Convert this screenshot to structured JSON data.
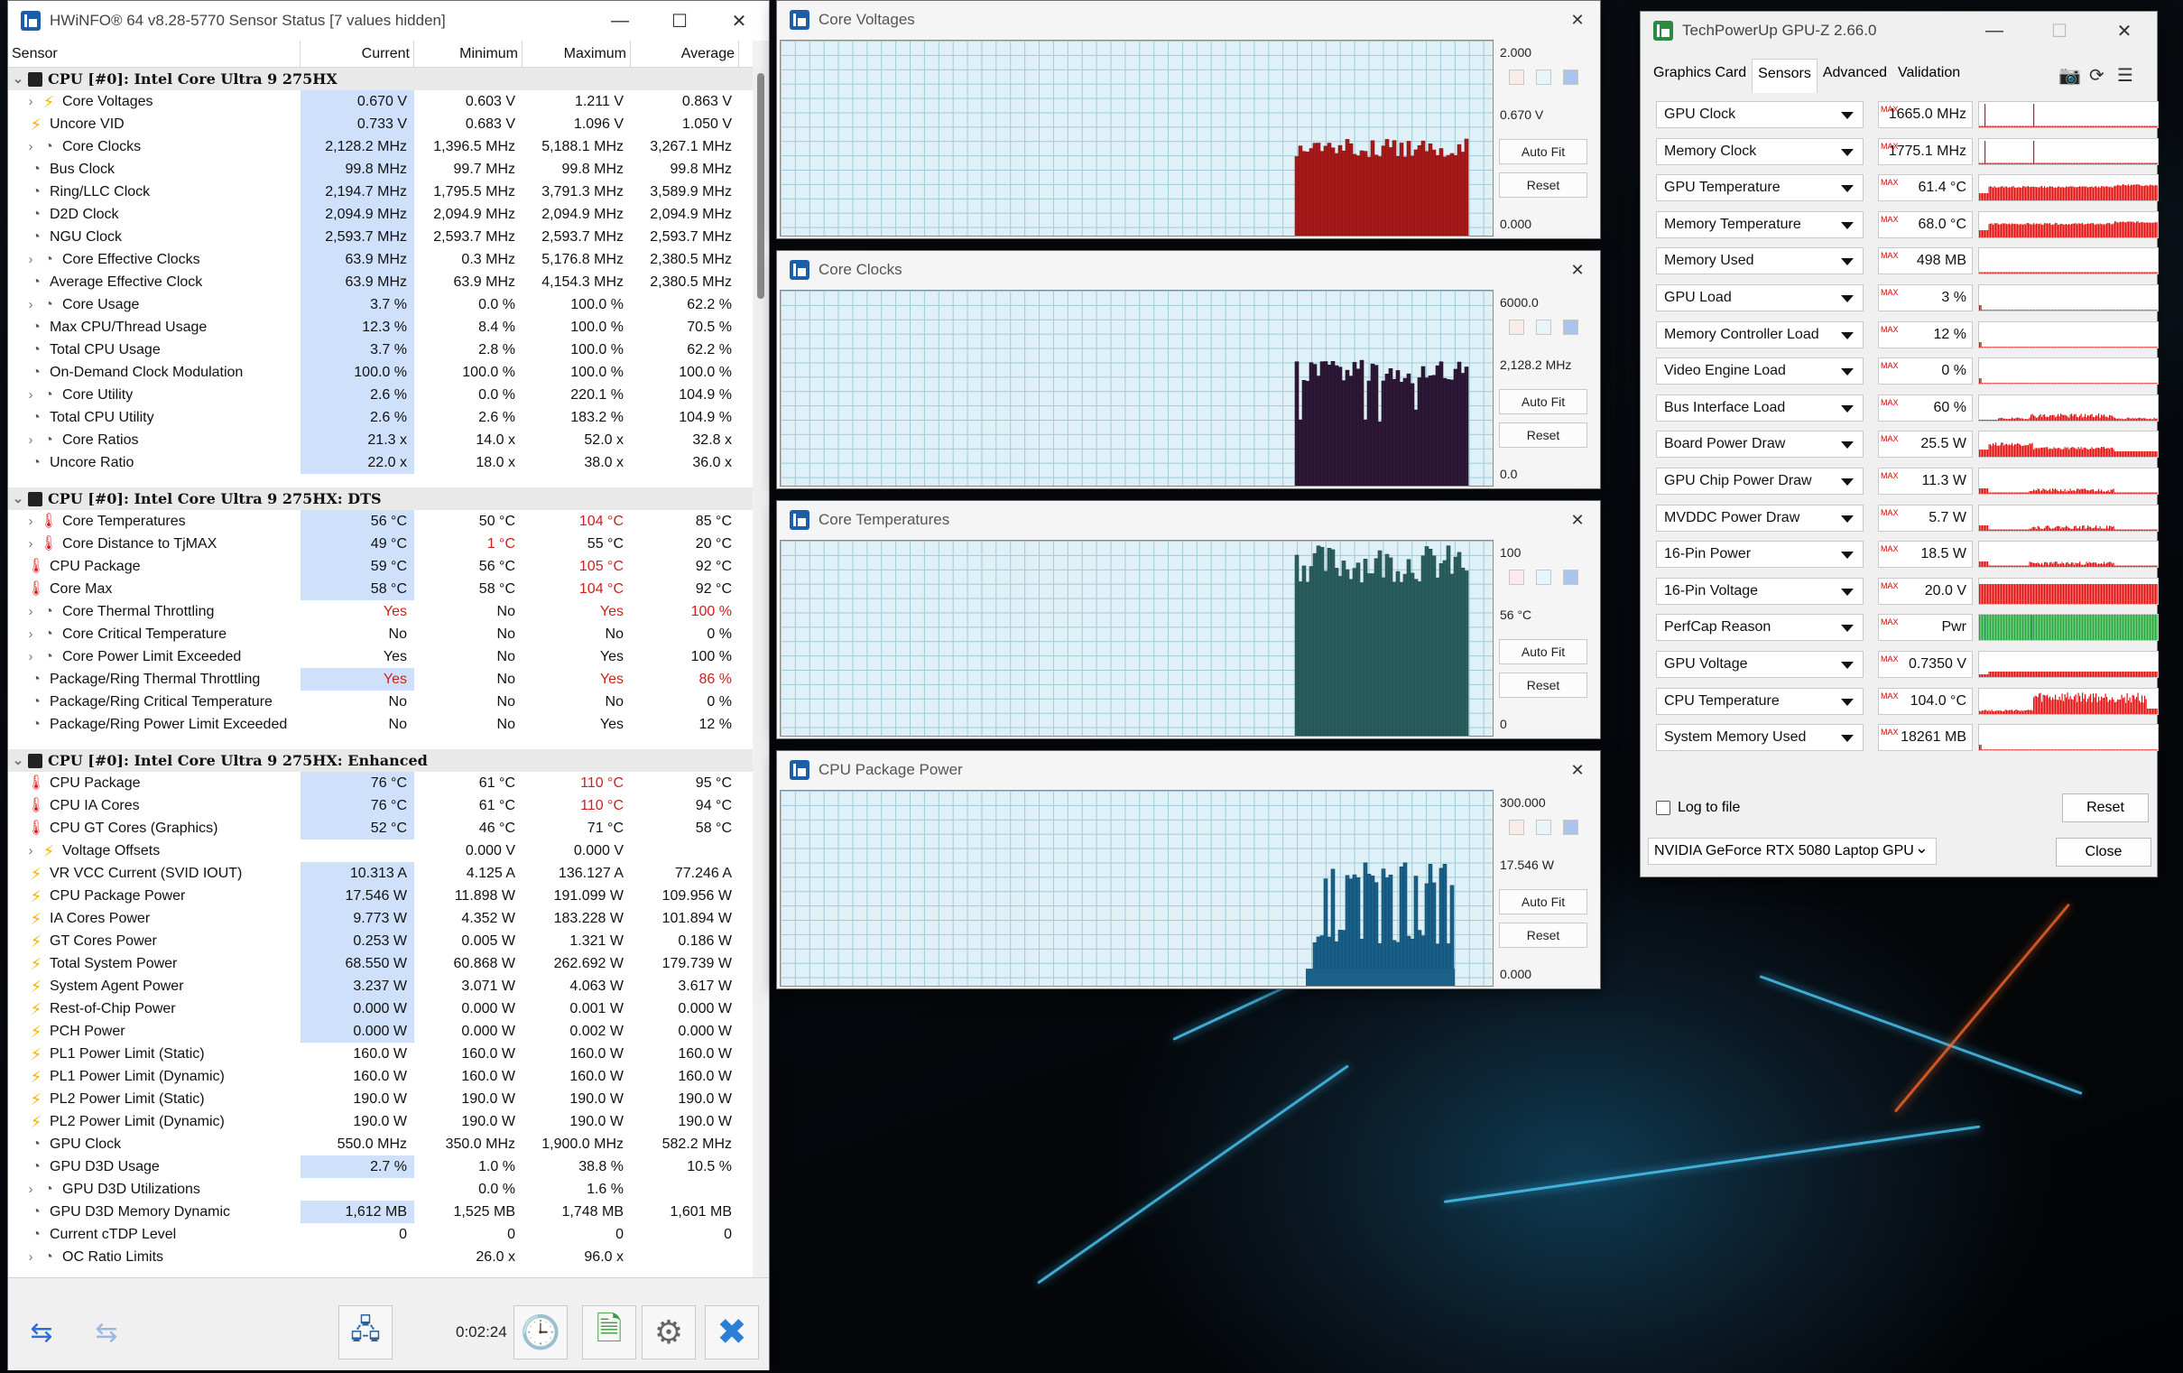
{
  "hw": {
    "title": "HWiNFO® 64 v8.28-5770 Sensor Status [7 values hidden]",
    "headers": [
      "Sensor",
      "Current",
      "Minimum",
      "Maximum",
      "Average"
    ],
    "timer": "0:02:24"
  },
  "groups": [
    {
      "name": "CPU [#0]: Intel Core Ultra 9 275HX",
      "rows": [
        {
          "e": 1,
          "i": "bolt",
          "n": "Core Voltages",
          "v": [
            "0.670 V",
            "0.603 V",
            "1.211 V",
            "0.863 V"
          ]
        },
        {
          "e": 0,
          "i": "bolt",
          "n": "Uncore VID",
          "v": [
            "0.733 V",
            "0.683 V",
            "1.096 V",
            "1.050 V"
          ]
        },
        {
          "e": 1,
          "i": "clk",
          "n": "Core Clocks",
          "v": [
            "2,128.2 MHz",
            "1,396.5 MHz",
            "5,188.1 MHz",
            "3,267.1 MHz"
          ]
        },
        {
          "e": 0,
          "i": "clk",
          "n": "Bus Clock",
          "v": [
            "99.8 MHz",
            "99.7 MHz",
            "99.8 MHz",
            "99.8 MHz"
          ]
        },
        {
          "e": 0,
          "i": "clk",
          "n": "Ring/LLC Clock",
          "v": [
            "2,194.7 MHz",
            "1,795.5 MHz",
            "3,791.3 MHz",
            "3,589.9 MHz"
          ]
        },
        {
          "e": 0,
          "i": "clk",
          "n": "D2D Clock",
          "v": [
            "2,094.9 MHz",
            "2,094.9 MHz",
            "2,094.9 MHz",
            "2,094.9 MHz"
          ]
        },
        {
          "e": 0,
          "i": "clk",
          "n": "NGU Clock",
          "v": [
            "2,593.7 MHz",
            "2,593.7 MHz",
            "2,593.7 MHz",
            "2,593.7 MHz"
          ]
        },
        {
          "e": 1,
          "i": "clk",
          "n": "Core Effective Clocks",
          "v": [
            "63.9 MHz",
            "0.3 MHz",
            "5,176.8 MHz",
            "2,380.5 MHz"
          ]
        },
        {
          "e": 0,
          "i": "clk",
          "n": "Average Effective Clock",
          "v": [
            "63.9 MHz",
            "63.9 MHz",
            "4,154.3 MHz",
            "2,380.5 MHz"
          ]
        },
        {
          "e": 1,
          "i": "clk",
          "n": "Core Usage",
          "v": [
            "3.7 %",
            "0.0 %",
            "100.0 %",
            "62.2 %"
          ]
        },
        {
          "e": 0,
          "i": "clk",
          "n": "Max CPU/Thread Usage",
          "v": [
            "12.3 %",
            "8.4 %",
            "100.0 %",
            "70.5 %"
          ]
        },
        {
          "e": 0,
          "i": "clk",
          "n": "Total CPU Usage",
          "v": [
            "3.7 %",
            "2.8 %",
            "100.0 %",
            "62.2 %"
          ]
        },
        {
          "e": 0,
          "i": "clk",
          "n": "On-Demand Clock Modulation",
          "v": [
            "100.0 %",
            "100.0 %",
            "100.0 %",
            "100.0 %"
          ]
        },
        {
          "e": 1,
          "i": "clk",
          "n": "Core Utility",
          "v": [
            "2.6 %",
            "0.0 %",
            "220.1 %",
            "104.9 %"
          ]
        },
        {
          "e": 0,
          "i": "clk",
          "n": "Total CPU Utility",
          "v": [
            "2.6 %",
            "2.6 %",
            "183.2 %",
            "104.9 %"
          ]
        },
        {
          "e": 1,
          "i": "clk",
          "n": "Core Ratios",
          "v": [
            "21.3 x",
            "14.0 x",
            "52.0 x",
            "32.8 x"
          ]
        },
        {
          "e": 0,
          "i": "clk",
          "n": "Uncore Ratio",
          "v": [
            "22.0 x",
            "18.0 x",
            "38.0 x",
            "36.0 x"
          ]
        }
      ]
    },
    {
      "name": "CPU [#0]: Intel Core Ultra 9 275HX: DTS",
      "rows": [
        {
          "e": 1,
          "i": "therm",
          "n": "Core Temperatures",
          "v": [
            "56 °C",
            "50 °C",
            "104 °C",
            "85 °C"
          ],
          "r": [
            2
          ]
        },
        {
          "e": 1,
          "i": "therm",
          "n": "Core Distance to TjMAX",
          "v": [
            "49 °C",
            "1 °C",
            "55 °C",
            "20 °C"
          ],
          "r": [
            1
          ]
        },
        {
          "e": 0,
          "i": "therm",
          "n": "CPU Package",
          "v": [
            "59 °C",
            "56 °C",
            "105 °C",
            "92 °C"
          ],
          "r": [
            2
          ]
        },
        {
          "e": 0,
          "i": "therm",
          "n": "Core Max",
          "v": [
            "58 °C",
            "58 °C",
            "104 °C",
            "92 °C"
          ],
          "r": [
            2
          ]
        },
        {
          "e": 1,
          "i": "clk",
          "n": "Core Thermal Throttling",
          "v": [
            "Yes",
            "No",
            "Yes",
            "100 %"
          ],
          "r": [
            0,
            2,
            3
          ],
          "nc": 1
        },
        {
          "e": 1,
          "i": "clk",
          "n": "Core Critical Temperature",
          "v": [
            "No",
            "No",
            "No",
            "0 %"
          ],
          "nc": 1
        },
        {
          "e": 1,
          "i": "clk",
          "n": "Core Power Limit Exceeded",
          "v": [
            "Yes",
            "No",
            "Yes",
            "100 %"
          ],
          "nc": 1
        },
        {
          "e": 0,
          "i": "clk",
          "n": "Package/Ring Thermal Throttling",
          "v": [
            "Yes",
            "No",
            "Yes",
            "86 %"
          ],
          "r": [
            0,
            2,
            3
          ]
        },
        {
          "e": 0,
          "i": "clk",
          "n": "Package/Ring Critical Temperature",
          "v": [
            "No",
            "No",
            "No",
            "0 %"
          ],
          "nc": 1
        },
        {
          "e": 0,
          "i": "clk",
          "n": "Package/Ring Power Limit Exceeded",
          "v": [
            "No",
            "No",
            "Yes",
            "12 %"
          ],
          "nc": 1
        }
      ]
    },
    {
      "name": "CPU [#0]: Intel Core Ultra 9 275HX: Enhanced",
      "rows": [
        {
          "e": 0,
          "i": "therm",
          "n": "CPU Package",
          "v": [
            "76 °C",
            "61 °C",
            "110 °C",
            "95 °C"
          ],
          "r": [
            2
          ]
        },
        {
          "e": 0,
          "i": "therm",
          "n": "CPU IA Cores",
          "v": [
            "76 °C",
            "61 °C",
            "110 °C",
            "94 °C"
          ],
          "r": [
            2
          ]
        },
        {
          "e": 0,
          "i": "therm",
          "n": "CPU GT Cores (Graphics)",
          "v": [
            "52 °C",
            "46 °C",
            "71 °C",
            "58 °C"
          ]
        },
        {
          "e": 1,
          "i": "bolt",
          "n": "Voltage Offsets",
          "v": [
            "",
            "0.000 V",
            "0.000 V",
            ""
          ],
          "nc": 1
        },
        {
          "e": 0,
          "i": "bolt",
          "n": "VR VCC Current (SVID IOUT)",
          "v": [
            "10.313 A",
            "4.125 A",
            "136.127 A",
            "77.246 A"
          ]
        },
        {
          "e": 0,
          "i": "bolt",
          "n": "CPU Package Power",
          "v": [
            "17.546 W",
            "11.898 W",
            "191.099 W",
            "109.956 W"
          ]
        },
        {
          "e": 0,
          "i": "bolt",
          "n": "IA Cores Power",
          "v": [
            "9.773 W",
            "4.352 W",
            "183.228 W",
            "101.894 W"
          ]
        },
        {
          "e": 0,
          "i": "bolt",
          "n": "GT Cores Power",
          "v": [
            "0.253 W",
            "0.005 W",
            "1.321 W",
            "0.186 W"
          ]
        },
        {
          "e": 0,
          "i": "bolt",
          "n": "Total System Power",
          "v": [
            "68.550 W",
            "60.868 W",
            "262.692 W",
            "179.739 W"
          ]
        },
        {
          "e": 0,
          "i": "bolt",
          "n": "System Agent Power",
          "v": [
            "3.237 W",
            "3.071 W",
            "4.063 W",
            "3.617 W"
          ]
        },
        {
          "e": 0,
          "i": "bolt",
          "n": "Rest-of-Chip Power",
          "v": [
            "0.000 W",
            "0.000 W",
            "0.001 W",
            "0.000 W"
          ]
        },
        {
          "e": 0,
          "i": "bolt",
          "n": "PCH Power",
          "v": [
            "0.000 W",
            "0.000 W",
            "0.002 W",
            "0.000 W"
          ]
        },
        {
          "e": 0,
          "i": "bolt",
          "n": "PL1 Power Limit (Static)",
          "v": [
            "160.0 W",
            "160.0 W",
            "160.0 W",
            "160.0 W"
          ],
          "nc": 1
        },
        {
          "e": 0,
          "i": "bolt",
          "n": "PL1 Power Limit (Dynamic)",
          "v": [
            "160.0 W",
            "160.0 W",
            "160.0 W",
            "160.0 W"
          ],
          "nc": 1
        },
        {
          "e": 0,
          "i": "bolt",
          "n": "PL2 Power Limit (Static)",
          "v": [
            "190.0 W",
            "190.0 W",
            "190.0 W",
            "190.0 W"
          ],
          "nc": 1
        },
        {
          "e": 0,
          "i": "bolt",
          "n": "PL2 Power Limit (Dynamic)",
          "v": [
            "190.0 W",
            "190.0 W",
            "190.0 W",
            "190.0 W"
          ],
          "nc": 1
        },
        {
          "e": 0,
          "i": "clk",
          "n": "GPU Clock",
          "v": [
            "550.0 MHz",
            "350.0 MHz",
            "1,900.0 MHz",
            "582.2 MHz"
          ],
          "nc": 1
        },
        {
          "e": 0,
          "i": "clk",
          "n": "GPU D3D Usage",
          "v": [
            "2.7 %",
            "1.0 %",
            "38.8 %",
            "10.5 %"
          ]
        },
        {
          "e": 1,
          "i": "clk",
          "n": "GPU D3D Utilizations",
          "v": [
            "",
            "0.0 %",
            "1.6 %",
            ""
          ],
          "nc": 1
        },
        {
          "e": 0,
          "i": "clk",
          "n": "GPU D3D Memory Dynamic",
          "v": [
            "1,612 MB",
            "1,525 MB",
            "1,748 MB",
            "1,601 MB"
          ]
        },
        {
          "e": 0,
          "i": "clk",
          "n": "Current cTDP Level",
          "v": [
            "0",
            "0",
            "0",
            "0"
          ],
          "nc": 1
        },
        {
          "e": 1,
          "i": "clk",
          "n": "OC Ratio Limits",
          "v": [
            "",
            "26.0 x",
            "96.0 x",
            ""
          ],
          "nc": 1
        }
      ]
    }
  ],
  "graphs": [
    {
      "title": "Core Voltages",
      "max": "2.000",
      "cur": "0.670 V",
      "min": "0.000",
      "color": "#8b1010",
      "fill": "#a61a1a",
      "seed": 1,
      "level": [
        0.35,
        0.5
      ],
      "fit": "Auto Fit",
      "reset": "Reset"
    },
    {
      "title": "Core Clocks",
      "max": "6000.0",
      "cur": "2,128.2 MHz",
      "min": "0.0",
      "color": "#200f24",
      "fill": "#2d1838",
      "seed": 2,
      "level": [
        0.35,
        0.65
      ],
      "fit": "Auto Fit",
      "reset": "Reset"
    },
    {
      "title": "Core Temperatures",
      "max": "100",
      "cur": "56 °C",
      "min": "0",
      "color": "#1f4a4a",
      "fill": "#2b5e5e",
      "seed": 3,
      "level": [
        0.5,
        0.98
      ],
      "fit": "Auto Fit",
      "reset": "Reset"
    },
    {
      "title": "CPU Package Power",
      "max": "300.000",
      "cur": "17.546 W",
      "min": "0.000",
      "color": "#0d4a6b",
      "fill": "#1a6088",
      "seed": 4,
      "level": [
        0.25,
        0.64
      ],
      "fit": "Auto Fit",
      "reset": "Reset"
    }
  ],
  "gz": {
    "title": "TechPowerUp GPU-Z 2.66.0",
    "tabs": [
      "Graphics Card",
      "Sensors",
      "Advanced",
      "Validation"
    ],
    "active_tab": 1,
    "max_tag": "MAX",
    "rows": [
      {
        "label": "GPU Clock",
        "value": "1665.0 MHz",
        "kind": "spikes"
      },
      {
        "label": "Memory Clock",
        "value": "1775.1 MHz",
        "kind": "spikes"
      },
      {
        "label": "GPU Temperature",
        "value": "61.4 °C",
        "kind": "high"
      },
      {
        "label": "Memory Temperature",
        "value": "68.0 °C",
        "kind": "high"
      },
      {
        "label": "Memory Used",
        "value": "498 MB",
        "kind": "low"
      },
      {
        "label": "GPU Load",
        "value": "3 %",
        "kind": "flat"
      },
      {
        "label": "Memory Controller Load",
        "value": "12 %",
        "kind": "flat"
      },
      {
        "label": "Video Engine Load",
        "value": "0 %",
        "kind": "flat"
      },
      {
        "label": "Bus Interface Load",
        "value": "60 %",
        "kind": "noise"
      },
      {
        "label": "Board Power Draw",
        "value": "25.5 W",
        "kind": "mid"
      },
      {
        "label": "GPU Chip Power Draw",
        "value": "11.3 W",
        "kind": "lownoise"
      },
      {
        "label": "MVDDC Power Draw",
        "value": "5.7 W",
        "kind": "lownoise"
      },
      {
        "label": "16-Pin Power",
        "value": "18.5 W",
        "kind": "lownoise"
      },
      {
        "label": "16-Pin Voltage",
        "value": "20.0 V",
        "kind": "full"
      },
      {
        "label": "PerfCap Reason",
        "value": "Pwr",
        "kind": "green"
      },
      {
        "label": "GPU Voltage",
        "value": "0.7350 V",
        "kind": "low2"
      },
      {
        "label": "CPU Temperature",
        "value": "104.0 °C",
        "kind": "cpu"
      },
      {
        "label": "System Memory Used",
        "value": "18261 MB",
        "kind": "flat"
      }
    ],
    "log": "Log to file",
    "reset": "Reset",
    "gpu": "NVIDIA GeForce RTX 5080 Laptop GPU",
    "close": "Close"
  }
}
